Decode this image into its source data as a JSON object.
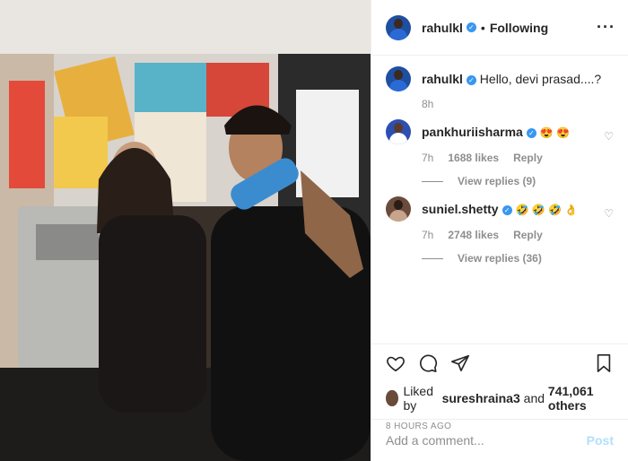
{
  "post": {
    "username": "rahulkl",
    "verified": true,
    "follow_status": "Following",
    "more_icon": "more-horizontal-icon"
  },
  "comments": [
    {
      "username": "rahulkl",
      "text": "Hello, devi prasad....?",
      "time": "8h",
      "verified": true
    },
    {
      "username": "pankhuriisharma",
      "text_emojis": "😍 😍",
      "time": "7h",
      "likes": "1688 likes",
      "reply_label": "Reply",
      "view_replies": "View replies (9)"
    },
    {
      "username": "suniel.shetty",
      "text_emojis": "🤣 🤣 🤣 👌",
      "time": "7h",
      "likes": "2748 likes",
      "reply_label": "Reply",
      "view_replies": "View replies (36)"
    }
  ],
  "actions": {
    "like_icon": "heart-icon",
    "comment_icon": "comment-icon",
    "share_icon": "share-icon",
    "save_icon": "bookmark-icon"
  },
  "likes": {
    "prefix": "Liked by",
    "user": "sureshraina3",
    "middle": "and",
    "others": "741,061 others"
  },
  "timestamp": "8 HOURS AGO",
  "add_comment": {
    "placeholder": "Add a comment...",
    "post_label": "Post"
  },
  "colors": {
    "verified": "#3897f0",
    "muted": "#8e8e8e",
    "post_disabled": "#b2dffc"
  }
}
